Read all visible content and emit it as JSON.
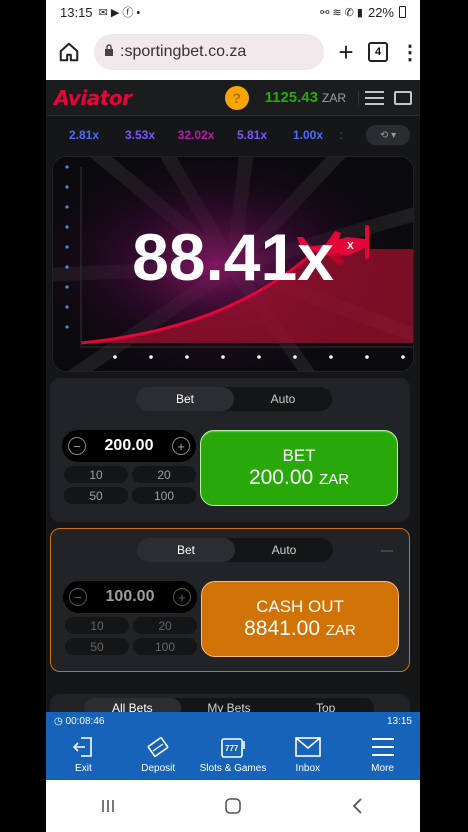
{
  "status": {
    "time": "13:15",
    "battery": "22%"
  },
  "browser": {
    "url": "sportingbet.co.za",
    "url_display": "sportingbet.co.za",
    "tab_count": "4"
  },
  "header": {
    "logo": "Aviator",
    "balance": "1125.43",
    "currency": "ZAR",
    "help_label": "?"
  },
  "multipliers": [
    {
      "value": "2.81x",
      "color": "#4b6cff"
    },
    {
      "value": "3.53x",
      "color": "#7a57ff"
    },
    {
      "value": "32.02x",
      "color": "#c017b4"
    },
    {
      "value": "5.81x",
      "color": "#7a57ff"
    },
    {
      "value": "1.00x",
      "color": "#4b6cff"
    }
  ],
  "multiplier_more": ":",
  "game": {
    "current_multiplier": "88.41x"
  },
  "bet_panels": [
    {
      "tabs": [
        "Bet",
        "Auto"
      ],
      "amount": "200.00",
      "quick": [
        "10",
        "20",
        "50",
        "100"
      ],
      "button_line1": "BET",
      "button_amount": "200.00",
      "button_currency": "ZAR"
    },
    {
      "tabs": [
        "Bet",
        "Auto"
      ],
      "amount": "100.00",
      "quick": [
        "10",
        "20",
        "50",
        "100"
      ],
      "button_line1": "CASH OUT",
      "button_amount": "8841.00",
      "button_currency": "ZAR"
    }
  ],
  "bets_tabs": [
    "All Bets",
    "My Bets",
    "Top"
  ],
  "bottom_nav": {
    "timer": "00:08:46",
    "clock": "13:15",
    "items": [
      "Exit",
      "Deposit",
      "Slots & Games",
      "Inbox",
      "More"
    ]
  },
  "colors": {
    "accent_red": "#e50539",
    "bet_green": "#28a909",
    "cashout_orange": "#d07206",
    "nav_blue": "#1763b9"
  }
}
